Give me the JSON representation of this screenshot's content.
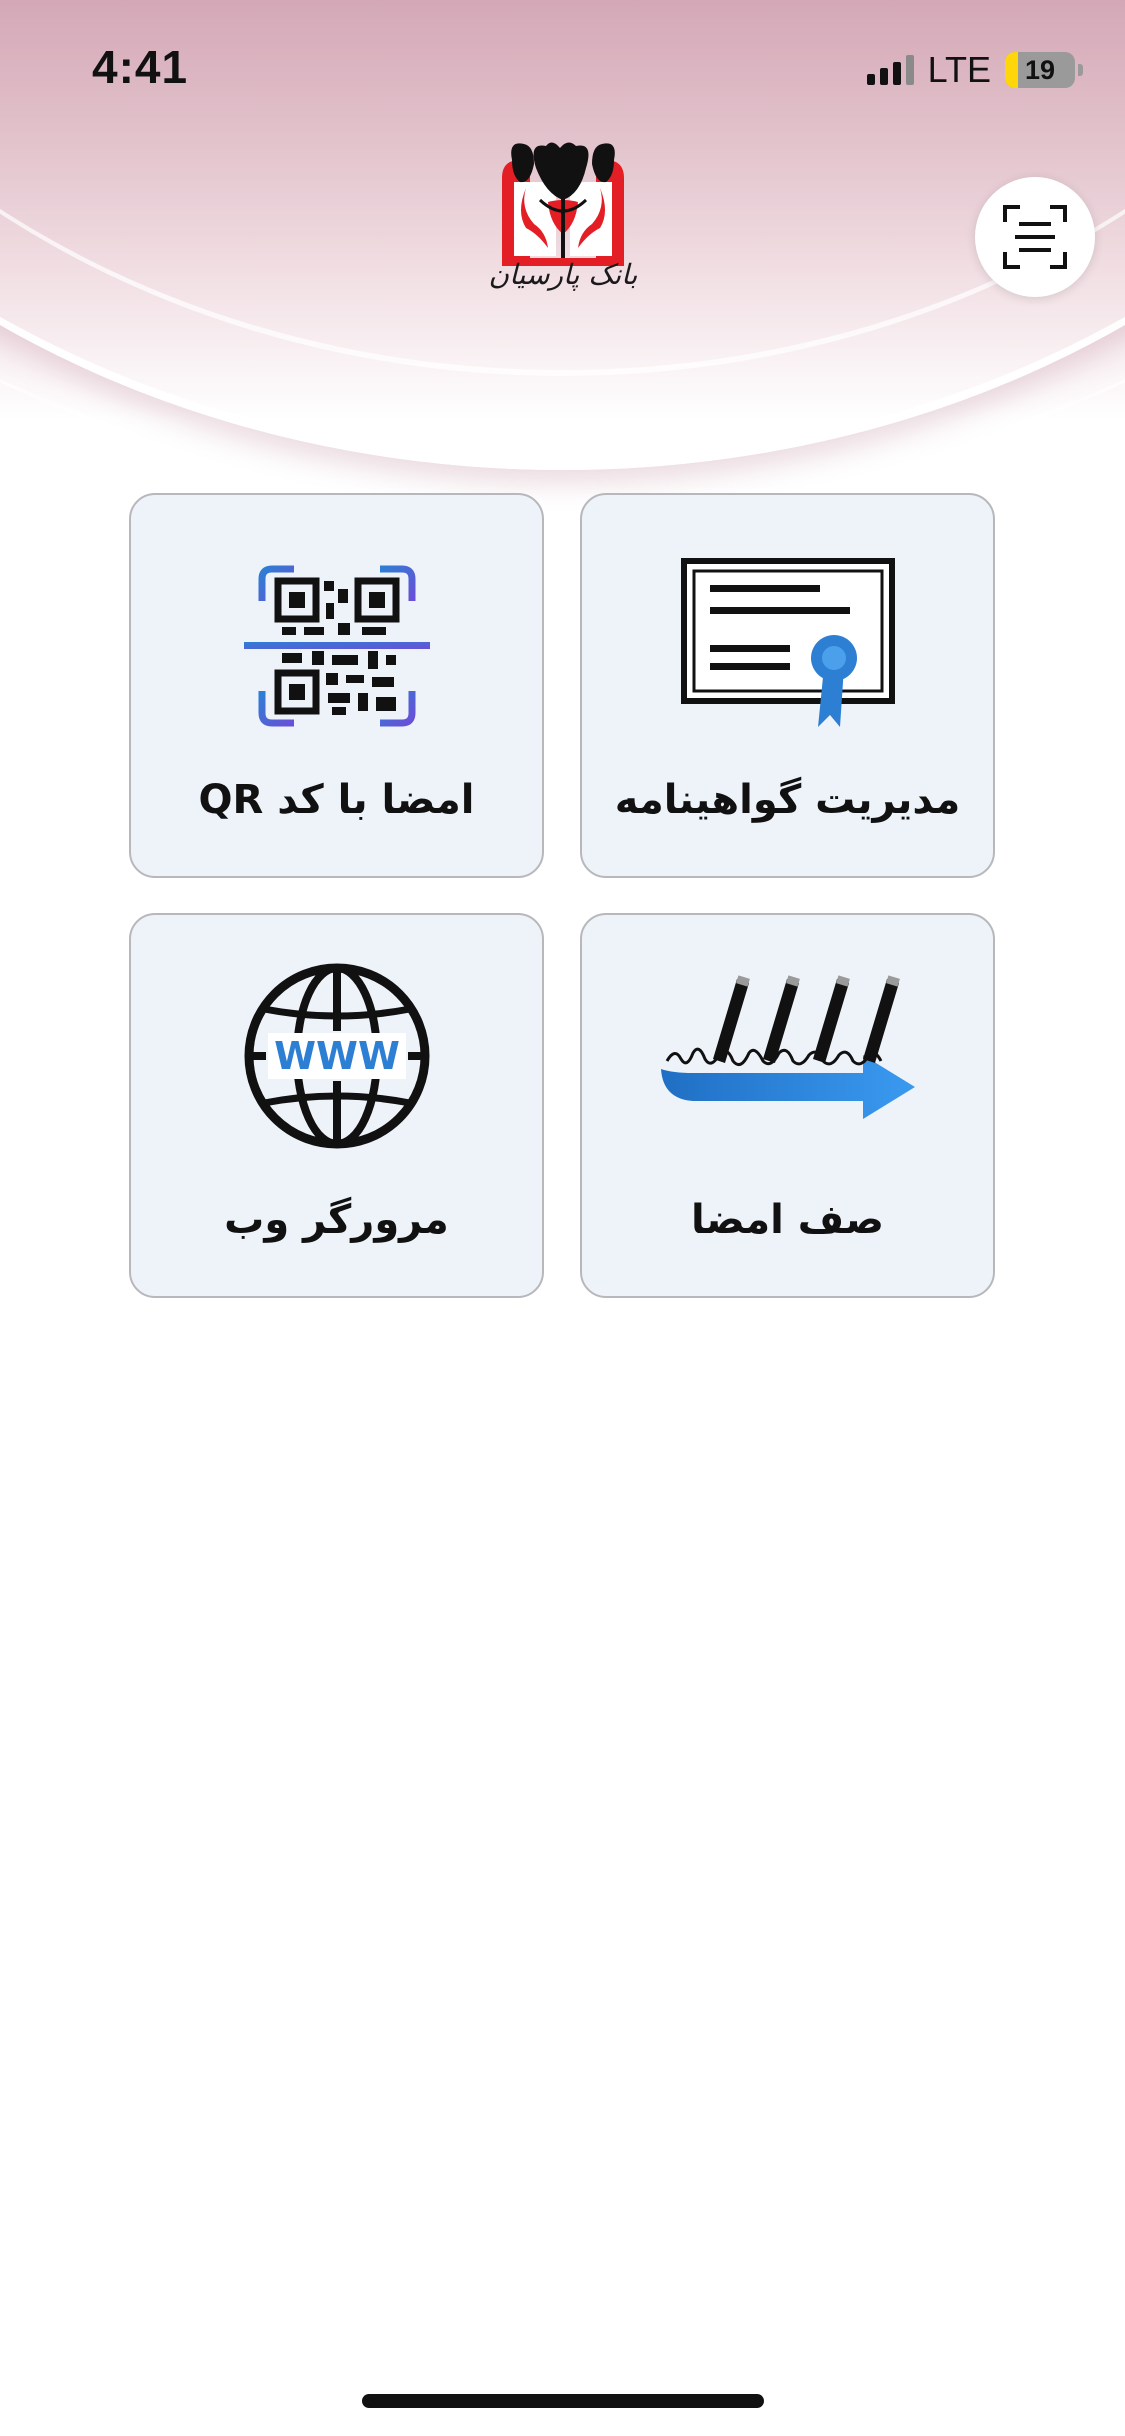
{
  "status_bar": {
    "time": "4:41",
    "network": "LTE",
    "battery_level": "19",
    "battery_fraction": 0.19,
    "signal_bars": 3,
    "signal_total": 4
  },
  "header": {
    "logo_text": "بانک پارسیان",
    "logo_icon": "parsian-bank-logo",
    "scan_icon": "document-scan-icon"
  },
  "tiles": [
    {
      "label": "مدیریت گواهینامه",
      "icon": "certificate-icon"
    },
    {
      "label": "امضا با کد QR",
      "icon": "qr-scan-icon"
    },
    {
      "label": "صف امضا",
      "icon": "signature-queue-icon"
    },
    {
      "label": "مرورگر وب",
      "icon": "www-globe-icon"
    }
  ],
  "globe_text": "WWW",
  "colors": {
    "header_top": "#d4a8b6",
    "tile_background": "#eef3fa",
    "tile_border": "#b8b8bc",
    "logo_red": "#e31e24",
    "accent_blue": "#2d7fd3",
    "accent_purple": "#6a4fd8",
    "battery_yellow": "#ffd60a"
  }
}
